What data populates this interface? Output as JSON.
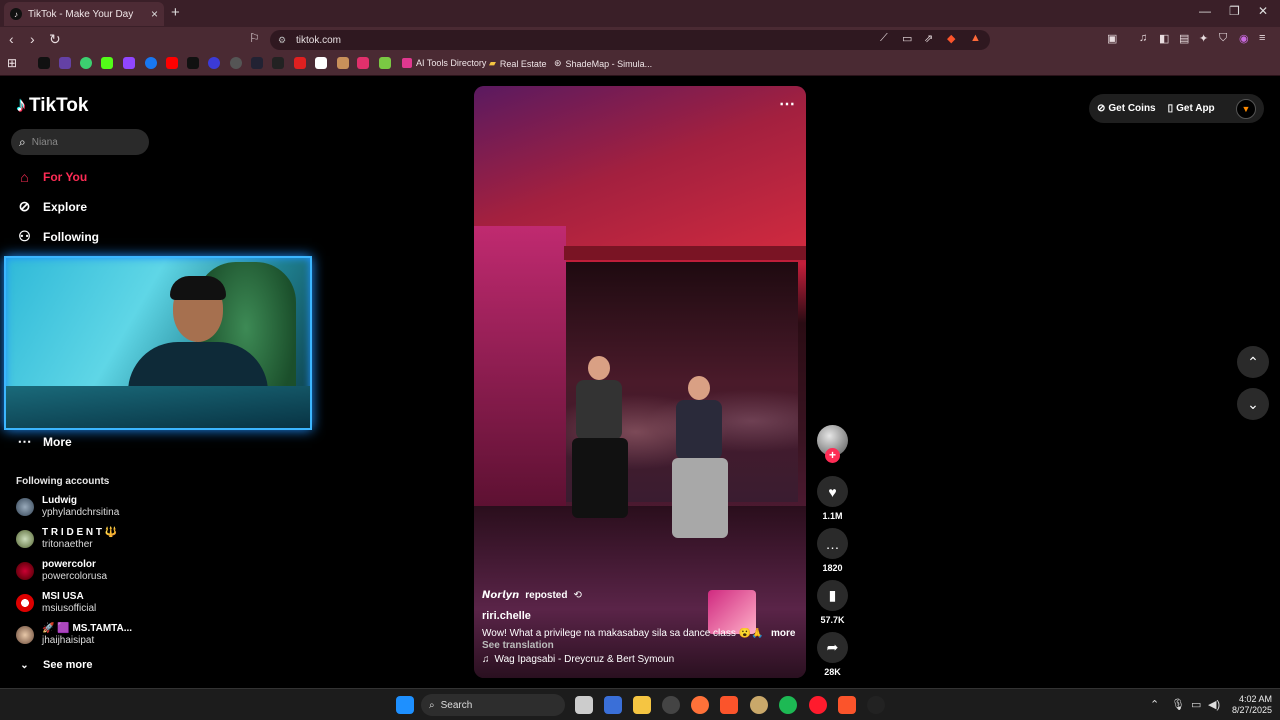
{
  "browser": {
    "tab_title": "TikTok - Make Your Day",
    "url": "tiktok.com",
    "bookmarks": [
      {
        "label": "AI Tools Directory"
      },
      {
        "label": "Real Estate"
      },
      {
        "label": "ShadeMap - Simula..."
      }
    ]
  },
  "sidebar": {
    "logo": "TikTok",
    "search_placeholder": "Niana",
    "nav": [
      {
        "label": "For You",
        "active": true
      },
      {
        "label": "Explore"
      },
      {
        "label": "Following"
      }
    ],
    "more_label": "More",
    "following_title": "Following accounts",
    "accounts": [
      {
        "name": "Ludwig",
        "handle": "yphylandchrsitina"
      },
      {
        "name": "T R I D E N T 🔱",
        "handle": "tritonaether"
      },
      {
        "name": "powercolor",
        "handle": "powercolorusa"
      },
      {
        "name": "MSI USA",
        "handle": "msiusofficial"
      },
      {
        "name": "🚀 🟪 MS.TAMTA...",
        "handle": "jhaijhaisipat"
      }
    ],
    "see_more": "See more"
  },
  "header": {
    "get_coins": "Get Coins",
    "get_app": "Get App"
  },
  "video": {
    "reposter": "𝙉𝙤𝙧𝙡𝙮𝙣",
    "reposted_label": "reposted",
    "author": "riri.chelle",
    "caption": "Wow! What a privilege na makasabay sila sa dance class 😮🙏 ...",
    "more": "more",
    "see_translation": "See translation",
    "music": "Wag Ipagsabi - Dreycruz & Bert Symoun",
    "likes": "1.1M",
    "comments": "1820",
    "saves": "57.7K",
    "shares": "28K"
  },
  "taskbar": {
    "search_label": "Search",
    "time": "4:02 AM",
    "date": "8/27/2025"
  },
  "colors": {
    "accent": "#fe2c55",
    "browser_bg": "#4a2a33"
  }
}
